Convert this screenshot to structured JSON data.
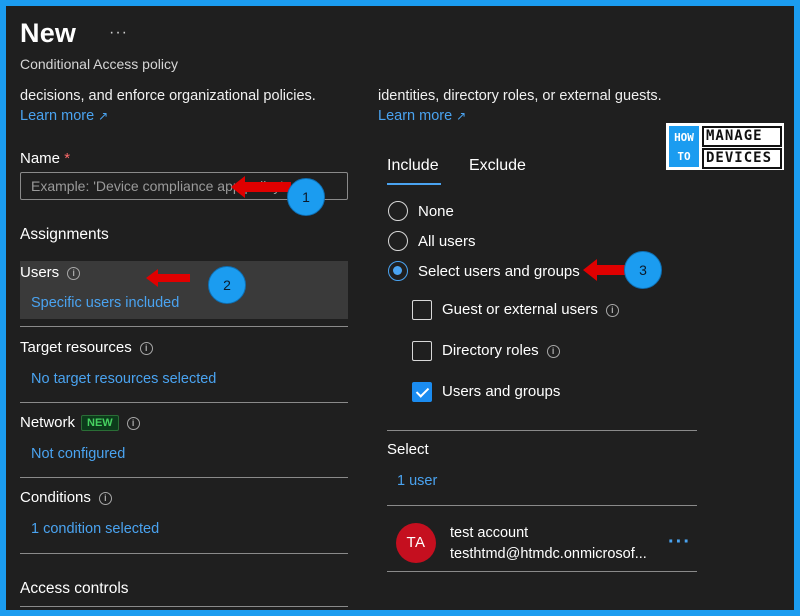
{
  "header": {
    "title": "New",
    "more": "···",
    "subtitle": "Conditional Access policy"
  },
  "left": {
    "desc": "decisions, and enforce organizational policies.",
    "learn_more": "Learn more",
    "name_label": "Name",
    "name_required": "*",
    "name_placeholder": "Example: 'Device compliance app policy'",
    "assignments": "Assignments",
    "users": {
      "label": "Users",
      "value": "Specific users included"
    },
    "target": {
      "label": "Target resources",
      "value": "No target resources selected"
    },
    "network": {
      "label": "Network",
      "badge": "NEW",
      "value": "Not configured"
    },
    "conditions": {
      "label": "Conditions",
      "value": "1 condition selected"
    },
    "access_controls": "Access controls"
  },
  "right": {
    "desc": "identities, directory roles, or external guests.",
    "learn_more": "Learn more",
    "tabs": [
      "Include",
      "Exclude"
    ],
    "radios": [
      {
        "label": "None",
        "selected": false
      },
      {
        "label": "All users",
        "selected": false
      },
      {
        "label": "Select users and groups",
        "selected": true
      }
    ],
    "checks": [
      {
        "label": "Guest or external users",
        "checked": false,
        "info": true
      },
      {
        "label": "Directory roles",
        "checked": false,
        "info": true
      },
      {
        "label": "Users and groups",
        "checked": true,
        "info": false
      }
    ],
    "select_label": "Select",
    "select_value": "1 user",
    "account": {
      "initials": "TA",
      "name": "test account",
      "email": "testhtmd@htmdc.onmicrosof..."
    }
  },
  "logo": {
    "how": "HOW",
    "to": "TO",
    "manage": "MANAGE",
    "devices": "DEVICES"
  },
  "callouts": [
    "1",
    "2",
    "3"
  ],
  "colors": {
    "accent": "#4aa3f0",
    "background": "#1f1f1f",
    "border": "#1b9cf0",
    "arrow": "#e00000",
    "avatar": "#c50f1f"
  }
}
